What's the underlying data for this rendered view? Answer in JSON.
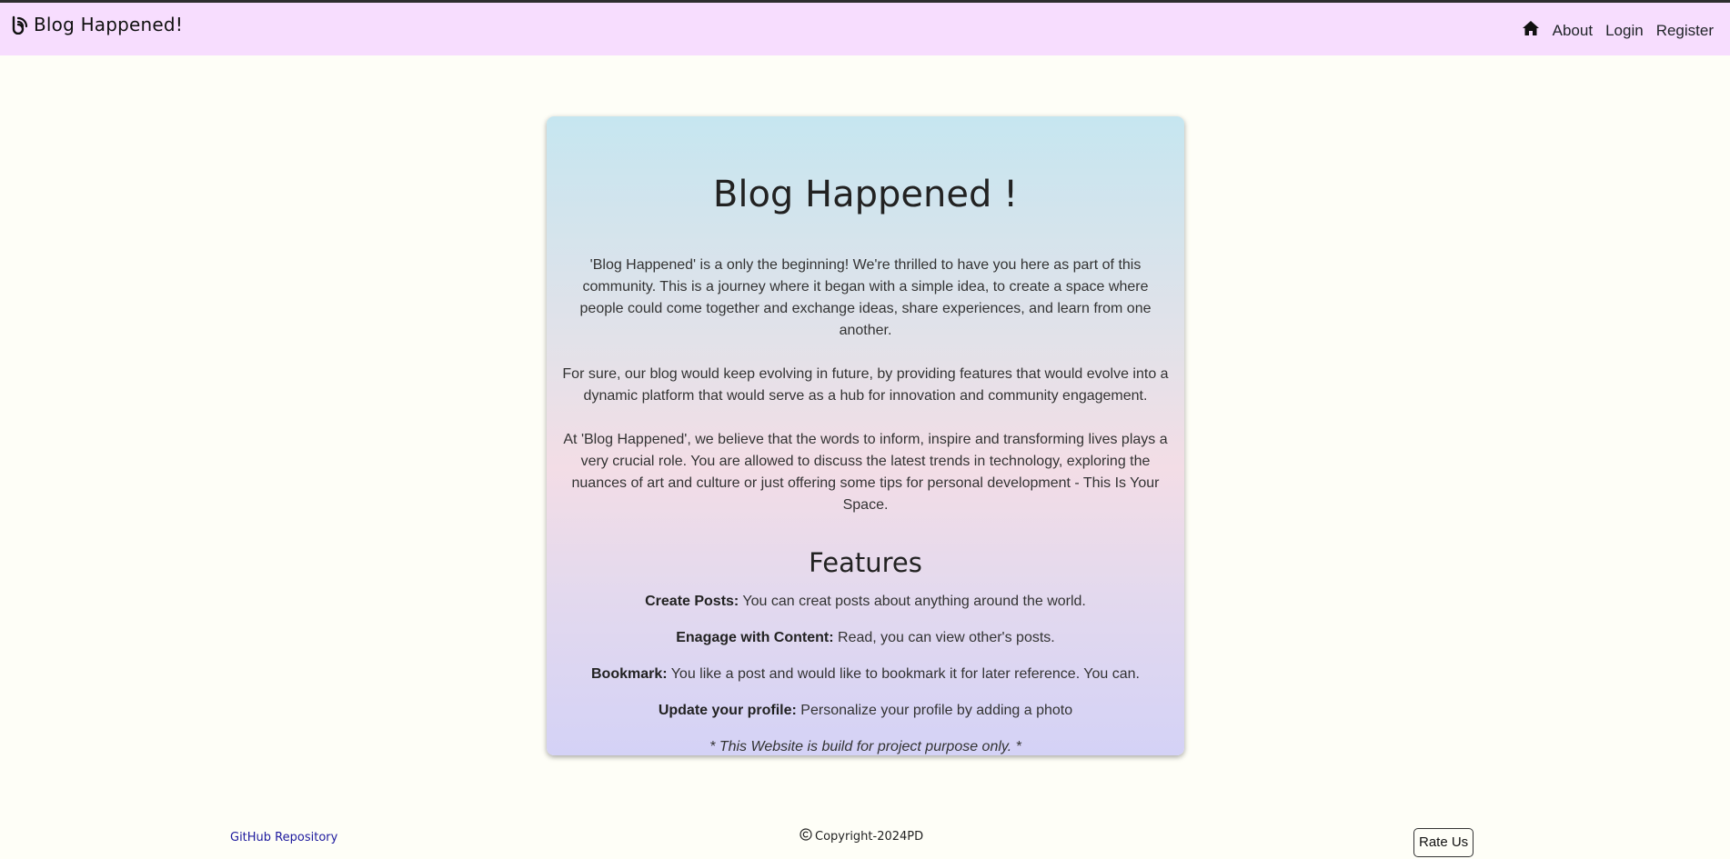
{
  "header": {
    "brand": "Blog Happened!",
    "nav": [
      {
        "icon": "home-icon",
        "label": ""
      },
      {
        "label": "About"
      },
      {
        "label": "Login"
      },
      {
        "label": "Register"
      }
    ]
  },
  "card": {
    "title": "Blog Happened !",
    "paragraphs": [
      "'Blog Happened' is a only the beginning! We're thrilled to have you here as part of this community. This is a journey where it began with a simple idea, to create a space where people could come together and exchange ideas, share experiences, and learn from one another.",
      "For sure, our blog would keep evolving in future, by providing features that would evolve into a dynamic platform that would serve as a hub for innovation and community engagement.",
      "At 'Blog Happened', we believe that the words to inform, inspire and transforming lives plays a very crucial role. You are allowed to discuss the latest trends in technology, exploring the nuances of art and culture or just offering some tips for personal development - This Is Your Space."
    ],
    "features_title": "Features",
    "features": [
      {
        "name": "Create Posts:",
        "text": " You can creat posts about anything around the world."
      },
      {
        "name": "Enagage with Content:",
        "text": " Read, you can view other's posts."
      },
      {
        "name": "Bookmark:",
        "text": " You like a post and would like to bookmark it for later reference. You can."
      },
      {
        "name": "Update your profile:",
        "text": " Personalize your profile by adding a photo"
      }
    ],
    "note": "* This Website is build for project purpose only. *"
  },
  "footer": {
    "github_link": "GitHub Repository",
    "copyright": "Copyright-2024PD",
    "rate_button": "Rate Us"
  },
  "colors": {
    "header_bg": "#f7ddfe",
    "page_bg": "#fefef7",
    "link": "#1e1a9e"
  }
}
